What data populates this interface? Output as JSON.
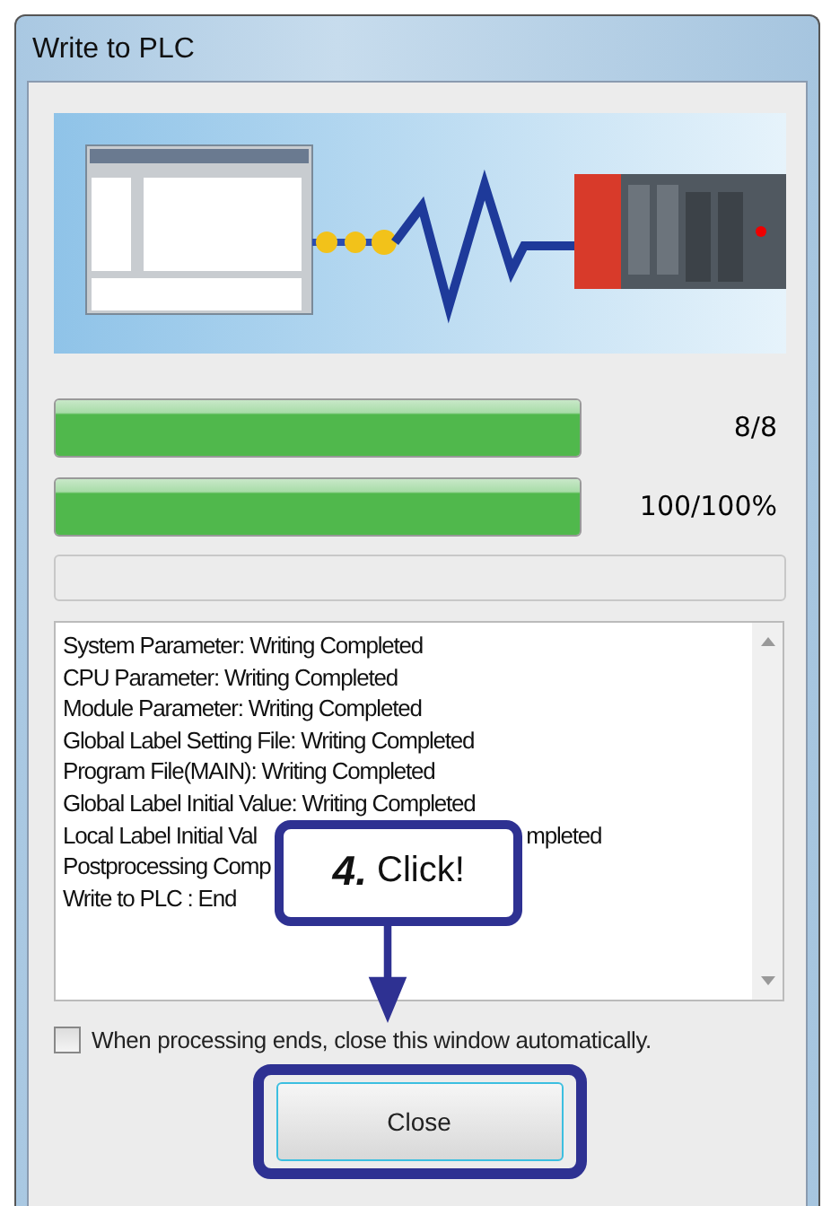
{
  "window": {
    "title": "Write to PLC"
  },
  "progress": [
    {
      "level": 1,
      "reading": "8/8"
    },
    {
      "level": 1,
      "reading": "100/100%"
    }
  ],
  "log": {
    "lines": [
      {
        "parts": [
          "System Parameter: Writing Completed"
        ]
      },
      {
        "parts": [
          "CPU Parameter: Writing Completed"
        ]
      },
      {
        "parts": [
          "Module Parameter: Writing Completed"
        ]
      },
      {
        "parts": [
          "Global Label Setting File: Writing Completed"
        ]
      },
      {
        "parts": [
          "Program File(MAIN): Writing Completed"
        ]
      },
      {
        "parts": [
          "Global Label Initial Value: Writing Completed"
        ]
      },
      {
        "parts": [
          "Local Label Initial Val",
          "mpleted"
        ],
        "callout": true
      },
      {
        "parts": [
          "Postprocessing Comp"
        ]
      },
      {
        "parts": [
          "Write to PLC : End"
        ]
      }
    ]
  },
  "auto_close": {
    "label": "When processing ends, close this window automatically.",
    "checked": false
  },
  "close_button": {
    "label": "Close"
  },
  "callout": {
    "step": "4.",
    "text": "Click!"
  }
}
